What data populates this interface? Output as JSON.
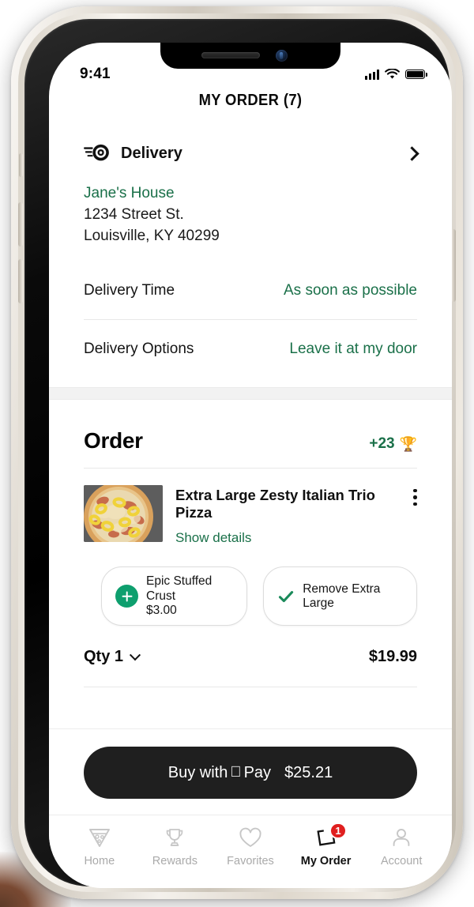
{
  "status_bar": {
    "time": "9:41",
    "signal_icon": "cellular-signal-icon",
    "wifi_icon": "wifi-icon",
    "battery_icon": "battery-full-icon"
  },
  "header": {
    "title": "MY ORDER (7)"
  },
  "delivery": {
    "icon": "delivery-speed-wheel-icon",
    "label": "Delivery",
    "chevron": "chevron-right-icon",
    "address_name": "Jane's House",
    "address_line1": "1234 Street St.",
    "address_line2": "Louisville, KY 40299",
    "rows": [
      {
        "key": "Delivery Time",
        "value": "As soon as possible"
      },
      {
        "key": "Delivery Options",
        "value": "Leave it at my door"
      }
    ]
  },
  "order": {
    "title": "Order",
    "points": "+23",
    "points_icon": "trophy-emoji",
    "item": {
      "name": "Extra Large Zesty Italian Trio Pizza",
      "thumbnail": "pizza-thumbnail",
      "details_link": "Show details",
      "menu_icon": "kebab-menu-icon",
      "chips": [
        {
          "icon": "plus-circle-icon",
          "label": "Epic Stuffed Crust",
          "sub": "$3.00"
        },
        {
          "icon": "check-icon",
          "label": "Remove Extra Large"
        }
      ],
      "qty_label": "Qty 1",
      "qty_chevron": "chevron-down-icon",
      "price": "$19.99"
    }
  },
  "pay": {
    "prefix": "Buy with",
    "apple_glyph": "apple-logo-icon",
    "pay_word": "Pay",
    "amount": "$25.21"
  },
  "tabs": [
    {
      "label": "Home",
      "icon": "pizza-slice-icon",
      "active": false,
      "badge": ""
    },
    {
      "label": "Rewards",
      "icon": "trophy-icon",
      "active": false,
      "badge": ""
    },
    {
      "label": "Favorites",
      "icon": "heart-icon",
      "active": false,
      "badge": ""
    },
    {
      "label": "My Order",
      "icon": "order-box-icon",
      "active": true,
      "badge": "1"
    },
    {
      "label": "Account",
      "icon": "person-icon",
      "active": false,
      "badge": ""
    }
  ],
  "colors": {
    "green_text": "#1a7049",
    "green_accent": "#0e9f6e",
    "badge_red": "#e01f1f",
    "pay_button": "#1f1f1f"
  }
}
